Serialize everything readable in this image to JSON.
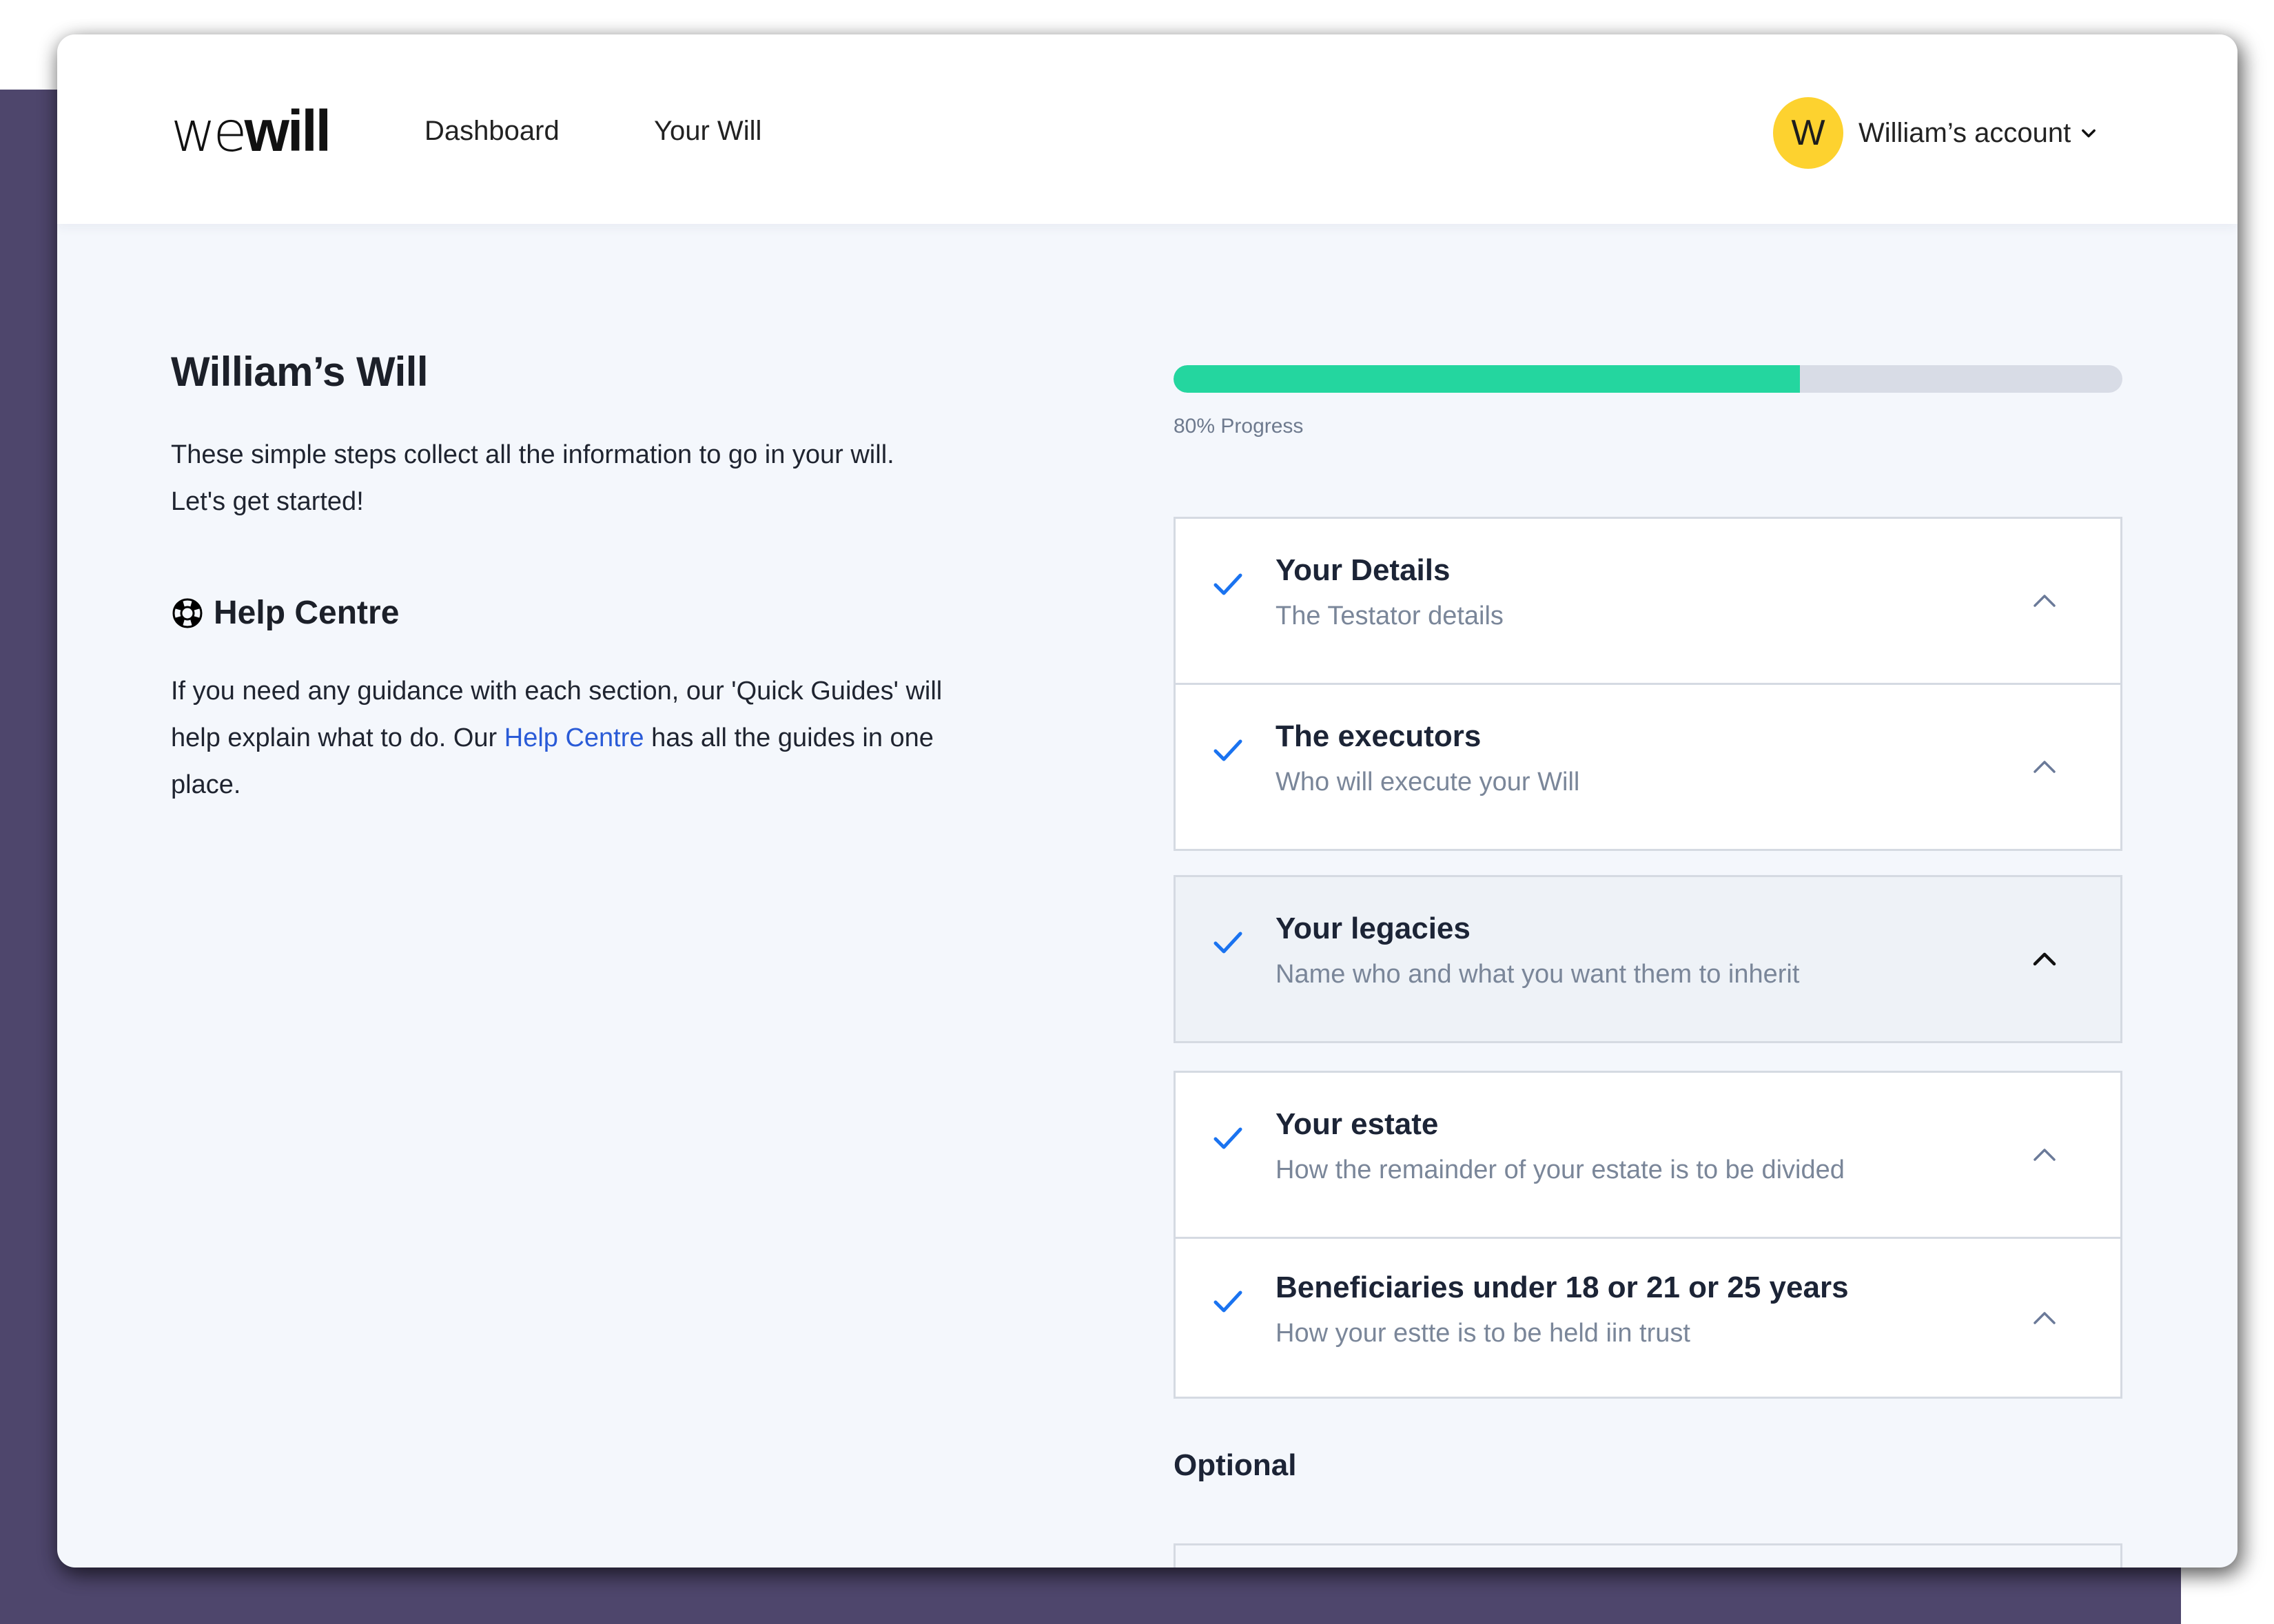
{
  "app": {
    "logo_prefix": "we",
    "logo_suffix": "will",
    "colors": {
      "backdrop": "#4e466c",
      "accent_green": "#24d69f",
      "check_blue": "#1a73f0",
      "link_blue": "#2a5bd7",
      "avatar_yellow": "#fdd22f"
    }
  },
  "nav": {
    "items": [
      {
        "label": "Dashboard"
      },
      {
        "label": "Your Will"
      }
    ]
  },
  "account": {
    "avatar_initial": "W",
    "label": "William’s account",
    "icon": "chevron-down-icon"
  },
  "intro": {
    "title": "William’s Will",
    "line1": "These simple steps collect all the information to go in your will.",
    "line2": "Let's get started!"
  },
  "help": {
    "icon": "life-ring-icon",
    "heading": "Help Centre",
    "text_before": "If you need any guidance with each section, our 'Quick Guides' will help explain what to do. Our ",
    "link_label": "Help Centre",
    "text_after": " has all the guides in one place."
  },
  "progress": {
    "label": "80% Progress",
    "percent": 80,
    "bar_fill_fraction": 0.66
  },
  "steps": [
    {
      "title": "Your Details",
      "subtitle": "The Testator details",
      "complete": true,
      "active": false,
      "icon": "chevron-up-icon"
    },
    {
      "title": "The executors",
      "subtitle": "Who will execute your Will",
      "complete": true,
      "active": false,
      "icon": "chevron-up-icon"
    },
    {
      "title": "Your legacies",
      "subtitle": "Name who and what you want them to inherit",
      "complete": true,
      "active": true,
      "icon": "chevron-up-icon"
    },
    {
      "title": "Your estate",
      "subtitle": "How the remainder of your estate is to be divided",
      "complete": true,
      "active": false,
      "icon": "chevron-up-icon"
    },
    {
      "title": "Beneficiaries under 18 or 21 or 25 years",
      "subtitle": "How your estte is to be held iin trust",
      "complete": true,
      "active": false,
      "icon": "chevron-up-icon"
    }
  ],
  "optional": {
    "heading": "Optional"
  }
}
